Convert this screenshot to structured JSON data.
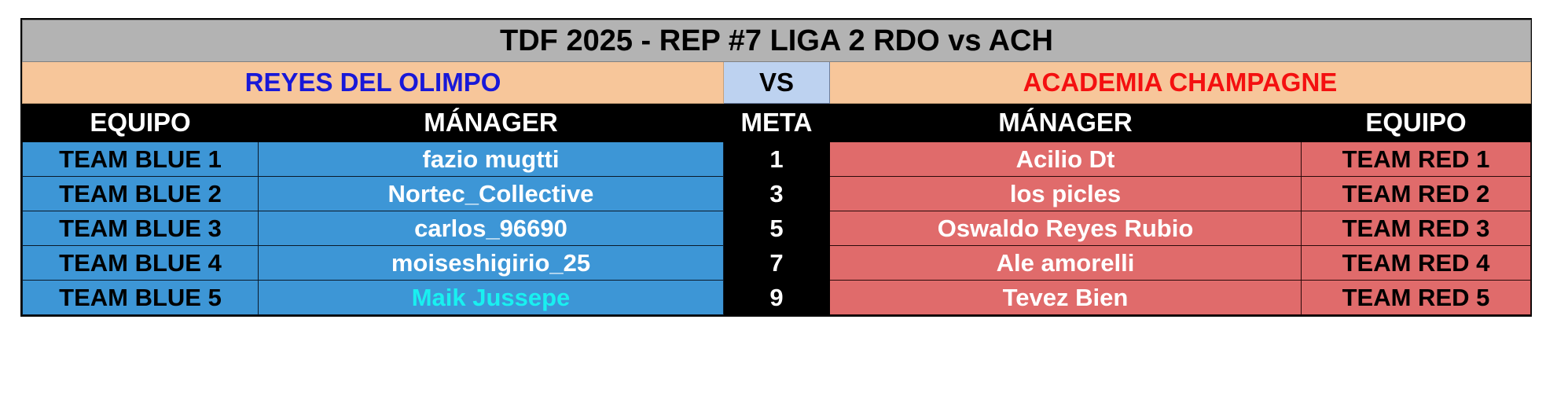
{
  "title": "TDF 2025 - REP #7 LIGA 2 RDO vs ACH",
  "matchup": {
    "left_team": "REYES DEL OLIMPO",
    "vs_label": "VS",
    "right_team": "ACADEMIA CHAMPAGNE"
  },
  "headers": {
    "equipo_left": "EQUIPO",
    "manager_left": "MÁNAGER",
    "meta": "META",
    "manager_right": "MÁNAGER",
    "equipo_right": "EQUIPO"
  },
  "colors": {
    "title_bg": "#b3b3b3",
    "team_bg": "#f7c69a",
    "vs_bg": "#bdd2f0",
    "left_team_text": "#1818d8",
    "right_team_text": "#f41010",
    "blue_row": "#3d96d6",
    "red_row": "#e06b6b",
    "header_bg": "#000000",
    "highlight_cyan": "#19f0f0"
  },
  "rows": [
    {
      "blue_team": "TEAM BLUE 1",
      "blue_manager": "fazio mugtti",
      "blue_manager_highlight": false,
      "meta": "1",
      "red_manager": "Acilio Dt",
      "red_team": "TEAM RED 1"
    },
    {
      "blue_team": "TEAM BLUE 2",
      "blue_manager": "Nortec_Collective",
      "blue_manager_highlight": false,
      "meta": "3",
      "red_manager": "los picles",
      "red_team": "TEAM RED 2"
    },
    {
      "blue_team": "TEAM BLUE 3",
      "blue_manager": "carlos_96690",
      "blue_manager_highlight": false,
      "meta": "5",
      "red_manager": "Oswaldo Reyes Rubio",
      "red_team": "TEAM RED 3"
    },
    {
      "blue_team": "TEAM BLUE 4",
      "blue_manager": "moiseshigirio_25",
      "blue_manager_highlight": false,
      "meta": "7",
      "red_manager": "Ale amorelli",
      "red_team": "TEAM RED 4"
    },
    {
      "blue_team": "TEAM BLUE 5",
      "blue_manager": "Maik Jussepe",
      "blue_manager_highlight": true,
      "meta": "9",
      "red_manager": "Tevez Bien",
      "red_team": "TEAM RED 5"
    }
  ]
}
